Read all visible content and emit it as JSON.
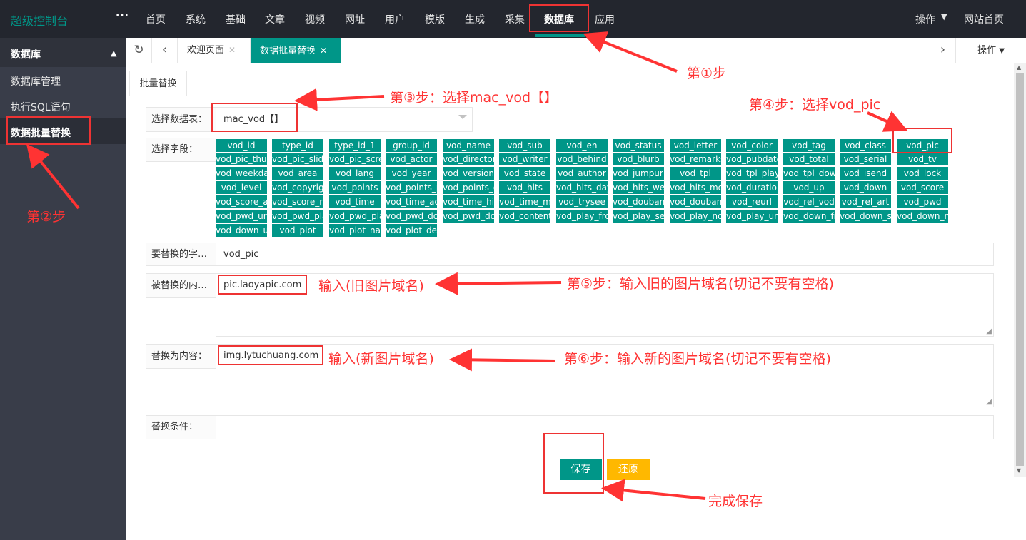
{
  "topbar": {
    "logo": "超级控制台",
    "more": "···",
    "nav": [
      "首页",
      "系统",
      "基础",
      "文章",
      "视频",
      "网址",
      "用户",
      "模版",
      "生成",
      "采集",
      "数据库",
      "应用"
    ],
    "active": "数据库",
    "right_op": "操作",
    "right_home": "网站首页"
  },
  "sidebar": {
    "title": "数据库",
    "items": [
      "数据库管理",
      "执行SQL语句",
      "数据批量替换"
    ]
  },
  "tabs": {
    "welcome": "欢迎页面",
    "current": "数据批量替换",
    "op": "操作"
  },
  "form": {
    "subtab": "批量替换",
    "table_label": "选择数据表：",
    "table_value": "mac_vod【】",
    "field_label": "选择字段：",
    "fields": [
      "vod_id",
      "type_id",
      "type_id_1",
      "group_id",
      "vod_name",
      "vod_sub",
      "vod_en",
      "vod_status",
      "vod_letter",
      "vod_color",
      "vod_tag",
      "vod_class",
      "vod_pic",
      "vod_pic_thumb",
      "vod_pic_slide",
      "vod_pic_screenshot",
      "vod_actor",
      "vod_director",
      "vod_writer",
      "vod_behind",
      "vod_blurb",
      "vod_remarks",
      "vod_pubdate",
      "vod_total",
      "vod_serial",
      "vod_tv",
      "vod_weekday",
      "vod_area",
      "vod_lang",
      "vod_year",
      "vod_version",
      "vod_state",
      "vod_author",
      "vod_jumpurl",
      "vod_tpl",
      "vod_tpl_play",
      "vod_tpl_down",
      "vod_isend",
      "vod_lock",
      "vod_level",
      "vod_copyright",
      "vod_points",
      "vod_points_play",
      "vod_points_down",
      "vod_hits",
      "vod_hits_day",
      "vod_hits_week",
      "vod_hits_month",
      "vod_duration",
      "vod_up",
      "vod_down",
      "vod_score",
      "vod_score_all",
      "vod_score_num",
      "vod_time",
      "vod_time_add",
      "vod_time_hits",
      "vod_time_make",
      "vod_trysee",
      "vod_douban_id",
      "vod_douban_score",
      "vod_reurl",
      "vod_rel_vod",
      "vod_rel_art",
      "vod_pwd",
      "vod_pwd_url",
      "vod_pwd_play",
      "vod_pwd_play_url",
      "vod_pwd_down",
      "vod_pwd_down_url",
      "vod_content",
      "vod_play_from",
      "vod_play_server",
      "vod_play_note",
      "vod_play_url",
      "vod_down_from",
      "vod_down_server",
      "vod_down_note",
      "vod_down_url",
      "vod_plot",
      "vod_plot_name",
      "vod_plot_detail"
    ],
    "replace_field_label": "要替换的字段：",
    "replace_field_value": "vod_pic",
    "old_label": "被替换的内容：",
    "old_value": "pic.laoyapic.com",
    "new_label": "替换为内容：",
    "new_value": "img.lytuchuang.com",
    "cond_label": "替换条件：",
    "cond_value": "",
    "save": "保存",
    "reset": "还原"
  },
  "annotations": {
    "step1": "第①步",
    "step2": "第②步",
    "step3": "第③步：选择mac_vod【】",
    "step4": "第④步：选择vod_pic",
    "step5_input": "输入(旧图片域名)",
    "step5": "第⑤步：输入旧的图片域名(切记不要有空格)",
    "step6_input": "输入(新图片域名)",
    "step6": "第⑥步：输入新的图片域名(切记不要有空格)",
    "done": "完成保存"
  },
  "colors": {
    "accent": "#009688",
    "warn": "#ffb800",
    "dark": "#23262e",
    "side": "#393d49",
    "annotation": "#ff3333"
  }
}
